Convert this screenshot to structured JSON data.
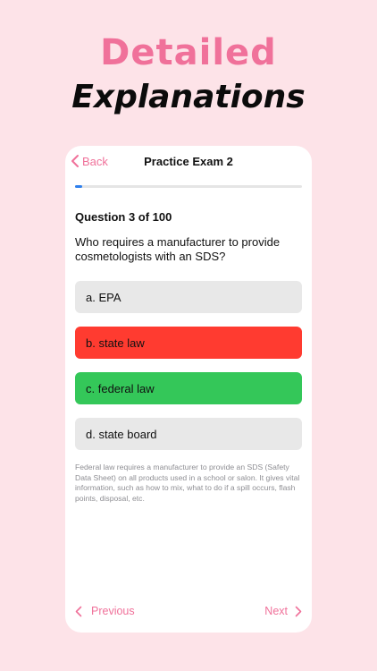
{
  "promo": {
    "headline_line1": "Detailed",
    "headline_line2": "Explanations"
  },
  "nav": {
    "back_label": "Back",
    "title": "Practice Exam 2"
  },
  "progress": {
    "current": 3,
    "total": 100,
    "fraction": 0.03
  },
  "question": {
    "counter": "Question 3 of 100",
    "text": "Who requires a manufacturer to provide cosmetologists with an SDS?"
  },
  "options": [
    {
      "label": "a. EPA",
      "state": "neutral"
    },
    {
      "label": "b. state law",
      "state": "incorrect"
    },
    {
      "label": "c. federal law",
      "state": "correct"
    },
    {
      "label": "d. state board",
      "state": "neutral"
    }
  ],
  "explanation": "Federal law requires a manufacturer to provide an SDS (Safety Data Sheet) on all products used in a school or salon. It gives vital information, such as how to mix, what to do if a spill occurs, flash points, disposal, etc.",
  "footer": {
    "previous_label": "Previous",
    "next_label": "Next"
  },
  "colors": {
    "background": "#fde3e8",
    "accent": "#f0719a",
    "incorrect": "#ff3b30",
    "correct": "#34c759",
    "neutral_option": "#e8e8e8",
    "progress": "#2f80ed"
  },
  "icons": {
    "back": "chevron-left-icon",
    "previous": "chevron-left-icon",
    "next": "chevron-right-icon"
  }
}
